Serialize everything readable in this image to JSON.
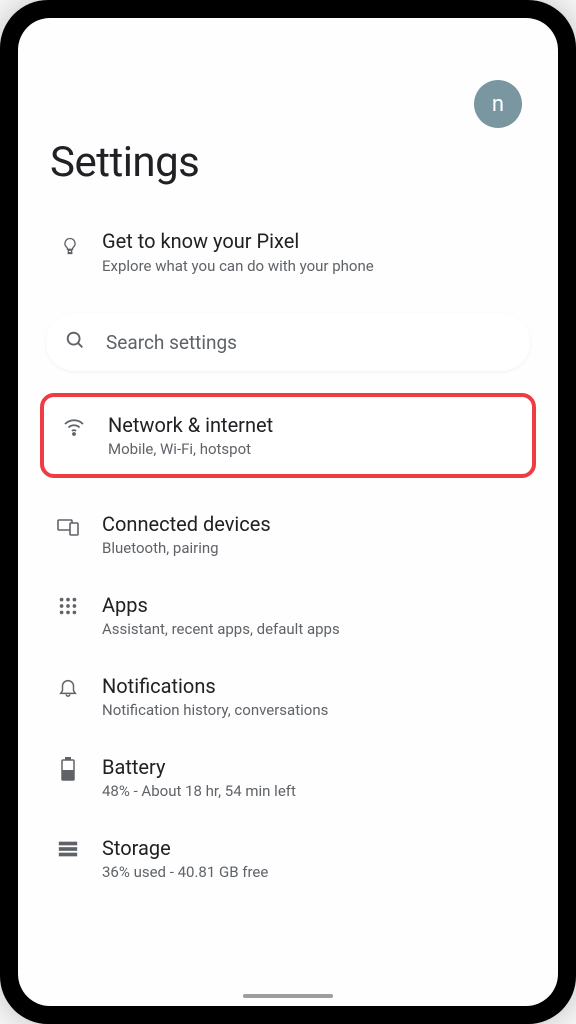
{
  "header": {
    "avatar_letter": "n"
  },
  "page_title": "Settings",
  "tip": {
    "title": "Get to know your Pixel",
    "subtitle": "Explore what you can do with your phone"
  },
  "search": {
    "placeholder": "Search settings"
  },
  "items": [
    {
      "title": "Network & internet",
      "subtitle": "Mobile, Wi-Fi, hotspot",
      "highlighted": true
    },
    {
      "title": "Connected devices",
      "subtitle": "Bluetooth, pairing"
    },
    {
      "title": "Apps",
      "subtitle": "Assistant, recent apps, default apps"
    },
    {
      "title": "Notifications",
      "subtitle": "Notification history, conversations"
    },
    {
      "title": "Battery",
      "subtitle": "48% - About 18 hr, 54 min left"
    },
    {
      "title": "Storage",
      "subtitle": "36% used - 40.81 GB free"
    }
  ]
}
